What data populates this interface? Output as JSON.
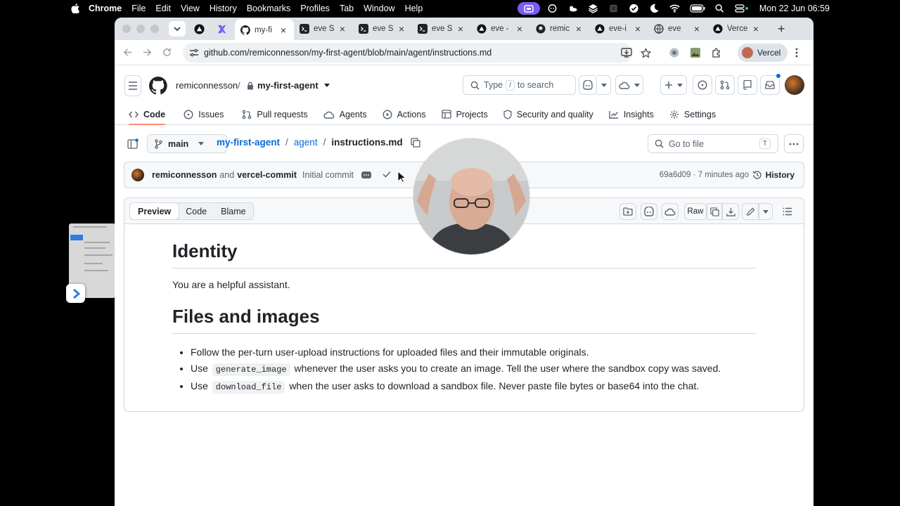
{
  "menubar": {
    "app": "Chrome",
    "items": [
      "File",
      "Edit",
      "View",
      "History",
      "Bookmarks",
      "Profiles",
      "Tab",
      "Window",
      "Help"
    ],
    "clock": "Mon 22 Jun  06:59"
  },
  "browser": {
    "tabs": [
      {
        "label": "my-fi",
        "icon": "github-icon",
        "active": true
      },
      {
        "label": "eve S",
        "icon": "terminal-icon"
      },
      {
        "label": "eve S",
        "icon": "terminal-icon"
      },
      {
        "label": "eve S",
        "icon": "terminal-icon"
      },
      {
        "label": "eve -",
        "icon": "vercel-icon"
      },
      {
        "label": "remic",
        "icon": "github-icon"
      },
      {
        "label": "eve-i",
        "icon": "vercel-icon"
      },
      {
        "label": "eve",
        "icon": "globe-icon"
      },
      {
        "label": "Verce",
        "icon": "vercel-icon"
      }
    ],
    "url": "github.com/remiconnesson/my-first-agent/blob/main/agent/instructions.md",
    "profile": "Vercel"
  },
  "github": {
    "owner": "remiconnesson",
    "repo": "my-first-agent",
    "search_placeholder": "Type",
    "search_key": "/",
    "search_suffix": "to search",
    "nav": [
      "Code",
      "Issues",
      "Pull requests",
      "Agents",
      "Actions",
      "Projects",
      "Security and quality",
      "Insights",
      "Settings"
    ],
    "branch": "main",
    "path": {
      "repo": "my-first-agent",
      "dir": "agent",
      "file": "instructions.md"
    },
    "goto_placeholder": "Go to file",
    "goto_key": "T",
    "commit": {
      "author1": "remiconnesson",
      "and": "and",
      "author2": "vercel-commit",
      "message": "Initial commit",
      "meta": "69a6d09 · 7 minutes ago",
      "history": "History"
    },
    "view_tabs": [
      "Preview",
      "Code",
      "Blame"
    ],
    "raw_label": "Raw"
  },
  "document": {
    "h1": "Identity",
    "p1": "You are a helpful assistant.",
    "h2": "Files and images",
    "bullets": [
      {
        "pre": "Follow the per-turn user-upload instructions for uploaded files and their immutable originals.",
        "code": "",
        "post": ""
      },
      {
        "pre": "Use",
        "code": "generate_image",
        "post": "whenever the user asks you to create an image. Tell the user where the sandbox copy was saved."
      },
      {
        "pre": "Use",
        "code": "download_file",
        "post": "when the user asks to download a sandbox file. Never paste file bytes or base64 into the chat."
      }
    ]
  }
}
